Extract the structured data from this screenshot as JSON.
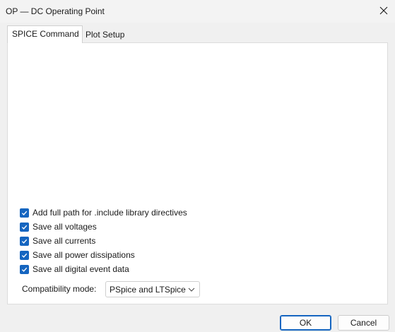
{
  "window": {
    "title": "OP  —  DC Operating Point"
  },
  "tabs": [
    {
      "label": "SPICE Command",
      "active": true
    },
    {
      "label": "Plot Setup",
      "active": false
    }
  ],
  "options": [
    {
      "label": "Add full path for .include library directives",
      "checked": true
    },
    {
      "label": "Save all voltages",
      "checked": true
    },
    {
      "label": "Save all currents",
      "checked": true
    },
    {
      "label": "Save all power dissipations",
      "checked": true
    },
    {
      "label": "Save all digital event data",
      "checked": true
    }
  ],
  "compatibility": {
    "label": "Compatibility mode:",
    "value": "PSpice and LTSpice"
  },
  "buttons": {
    "ok": "OK",
    "cancel": "Cancel"
  },
  "colors": {
    "accent": "#1565c0",
    "background": "#f0f0f0",
    "panel": "#ffffff"
  },
  "icons": {
    "close": "close-icon",
    "checkbox": "checkmark-icon",
    "dropdown": "chevron-down-icon"
  }
}
